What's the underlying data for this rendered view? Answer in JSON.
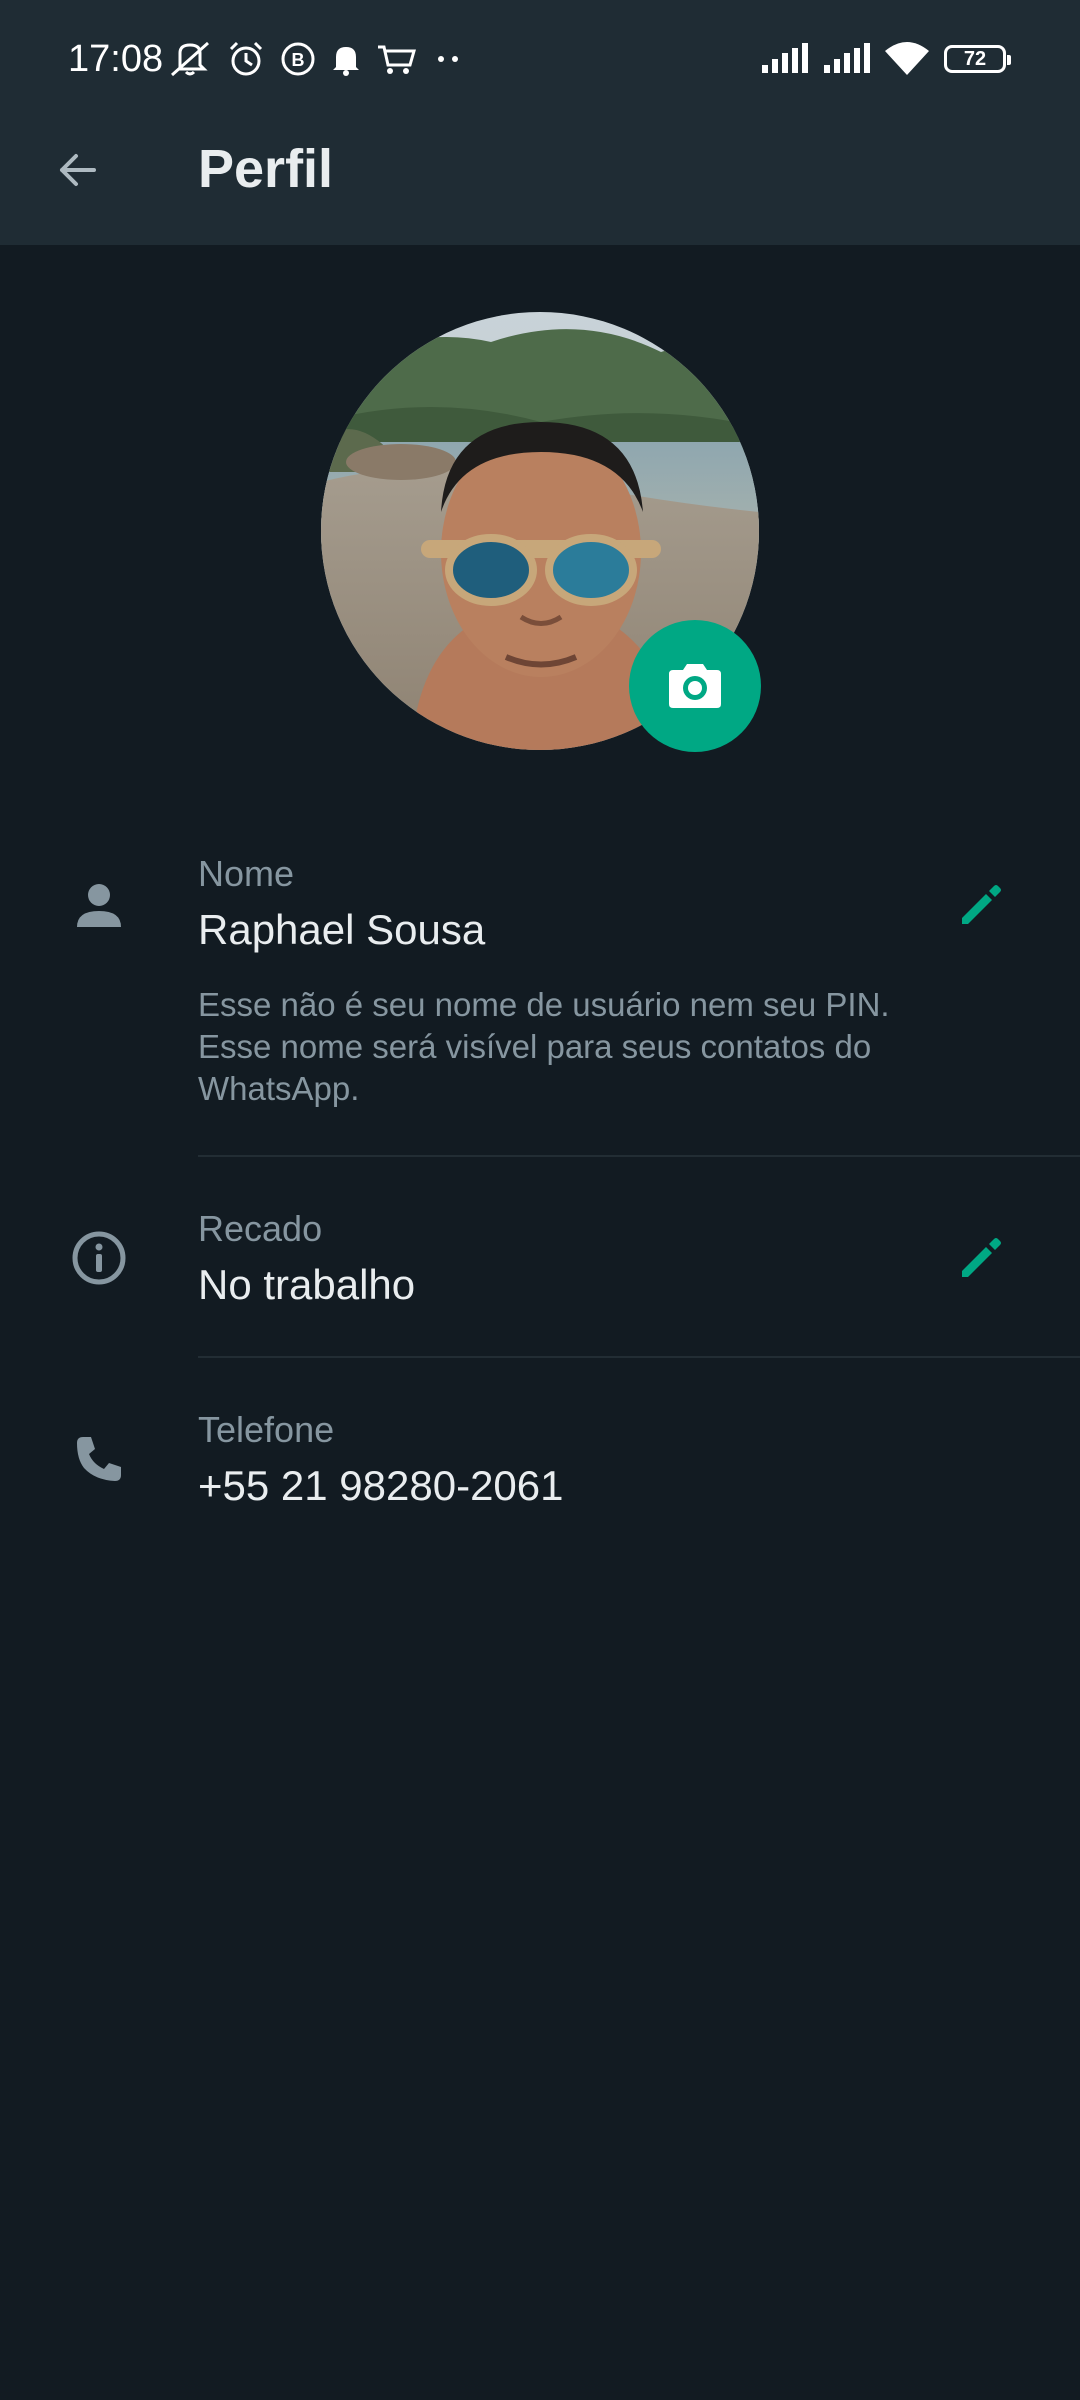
{
  "status_bar": {
    "time": "17:08",
    "battery": "72"
  },
  "header": {
    "title": "Perfil",
    "back_icon": "arrow-back-icon"
  },
  "profile": {
    "photo": "profile-photo",
    "camera_icon": "camera-icon"
  },
  "name_section": {
    "label": "Nome",
    "value": "Raphael Sousa",
    "hint_line1": "Esse não é seu nome de usuário nem seu PIN.",
    "hint_line2": "Esse nome será visível para seus contatos do",
    "hint_line3": "WhatsApp.",
    "icon": "person-icon",
    "edit_icon": "pencil-icon"
  },
  "about_section": {
    "label": "Recado",
    "value": "No trabalho",
    "icon": "info-icon",
    "edit_icon": "pencil-icon"
  },
  "phone_section": {
    "label": "Telefone",
    "value": "+55 21 98280-2061",
    "icon": "phone-icon"
  },
  "colors": {
    "background": "#121B22",
    "app_bar": "#1F2C34",
    "accent": "#00A884",
    "primary_text": "#E9EDEF",
    "secondary_text": "#8696A0"
  }
}
